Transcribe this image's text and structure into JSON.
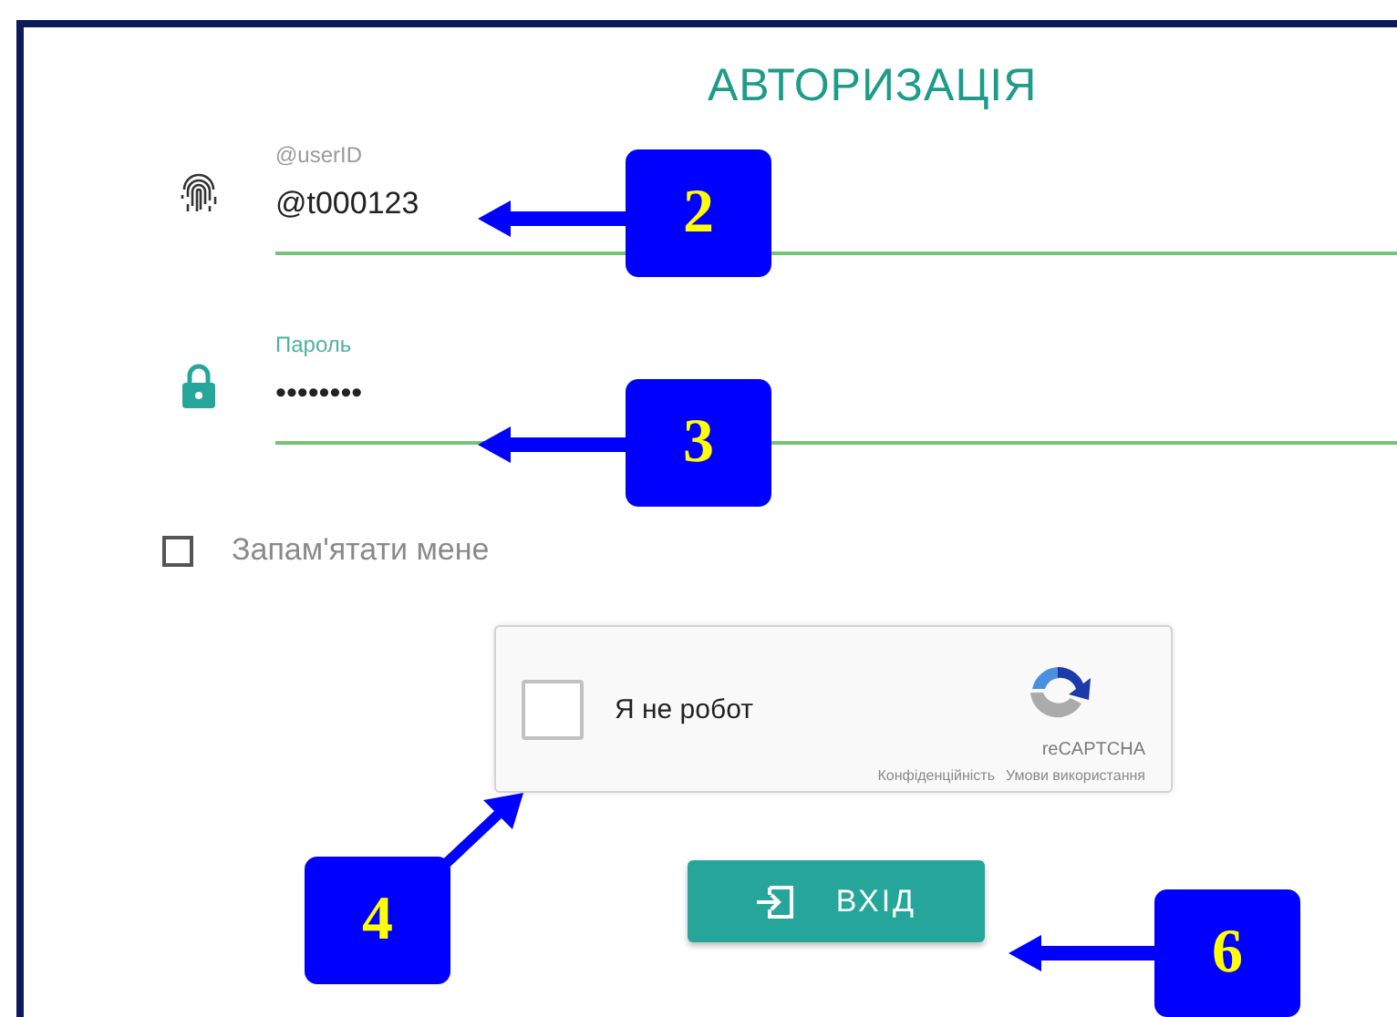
{
  "title": "АВТОРИЗАЦІЯ",
  "fields": [
    {
      "kind": "text",
      "label": "@userID",
      "value": "@t000123",
      "focused": false
    },
    {
      "kind": "password",
      "label": "Пароль",
      "value": "••••••••",
      "focused": true
    }
  ],
  "remember": {
    "label": "Запам'ятати мене",
    "checked": false
  },
  "captcha": {
    "label": "Я не робот",
    "checked": false,
    "brand": "reCAPTCHA",
    "links": [
      "Конфіденційність",
      "Умови використання"
    ]
  },
  "submit_button": {
    "label": "ВХІД"
  },
  "callouts": [
    {
      "number": "2"
    },
    {
      "number": "3"
    },
    {
      "number": "4"
    },
    {
      "number": "6"
    }
  ]
}
